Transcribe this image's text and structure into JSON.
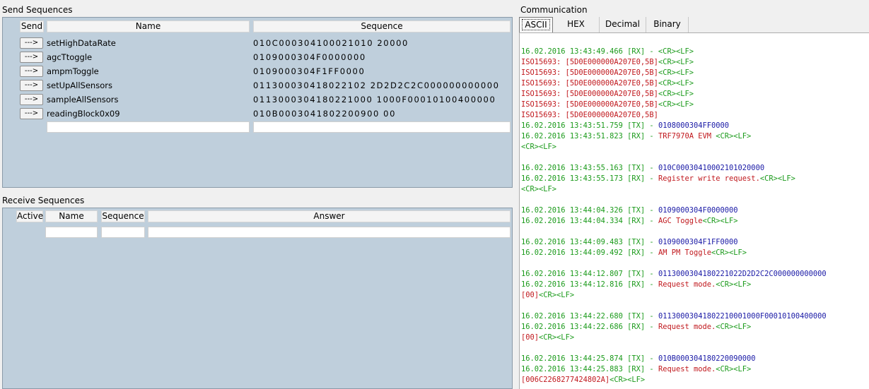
{
  "send_sequences": {
    "title": "Send Sequences",
    "headers": {
      "send": "Send",
      "name": "Name",
      "sequence": "Sequence"
    },
    "rows": [
      {
        "button": "--->",
        "name": "setHighDataRate",
        "sequence": "010C000304100021010 20000"
      },
      {
        "button": "--->",
        "name": "agcTtoggle",
        "sequence": "0109000304F0000000"
      },
      {
        "button": "--->",
        "name": "ampmToggle",
        "sequence": "0109000304F1FF0000"
      },
      {
        "button": "--->",
        "name": "setUpAllSensors",
        "sequence": "011300030418022102 2D2D2C2C000000000000"
      },
      {
        "button": "--->",
        "name": "sampleAllSensors",
        "sequence": "0113000304180221000 1000F00010100400000"
      },
      {
        "button": "--->",
        "name": "readingBlock0x09",
        "sequence": "010B0003041802200900 00"
      }
    ]
  },
  "receive_sequences": {
    "title": "Receive Sequences",
    "headers": {
      "active": "Active",
      "name": "Name",
      "sequence": "Sequence",
      "answer": "Answer"
    }
  },
  "communication": {
    "title": "Communication",
    "tabs": [
      "ASCII",
      "HEX",
      "Decimal",
      "Binary"
    ],
    "active_tab": "ASCII",
    "colors": {
      "timestamp": "#1a9a1a",
      "error": "#c0181d",
      "tx_data": "#1a1aa6"
    },
    "log": [
      [
        {
          "t": "16.02.2016 13:43:49.466 [RX] - <CR><LF>",
          "c": "green"
        }
      ],
      [
        {
          "t": "ISO15693: [5D0E000000A207E0,5B]",
          "c": "red"
        },
        {
          "t": "<CR><LF>",
          "c": "green"
        }
      ],
      [
        {
          "t": "ISO15693: [5D0E000000A207E0,5B]",
          "c": "red"
        },
        {
          "t": "<CR><LF>",
          "c": "green"
        }
      ],
      [
        {
          "t": "ISO15693: [5D0E000000A207E0,5B]",
          "c": "red"
        },
        {
          "t": "<CR><LF>",
          "c": "green"
        }
      ],
      [
        {
          "t": "ISO15693: [5D0E000000A207E0,5B]",
          "c": "red"
        },
        {
          "t": "<CR><LF>",
          "c": "green"
        }
      ],
      [
        {
          "t": "ISO15693: [5D0E000000A207E0,5B]",
          "c": "red"
        },
        {
          "t": "<CR><LF>",
          "c": "green"
        }
      ],
      [
        {
          "t": "ISO15693: [5D0E000000A207E0,5B]",
          "c": "red"
        }
      ],
      [
        {
          "t": "16.02.2016 13:43:51.759 [TX] - ",
          "c": "green"
        },
        {
          "t": "0108000304FF0000",
          "c": "blue"
        }
      ],
      [
        {
          "t": "16.02.2016 13:43:51.823 [RX] - ",
          "c": "green"
        },
        {
          "t": "TRF7970A EVM ",
          "c": "red"
        },
        {
          "t": "<CR><LF>",
          "c": "green"
        }
      ],
      [
        {
          "t": "<CR><LF>",
          "c": "green"
        }
      ],
      [],
      [
        {
          "t": "16.02.2016 13:43:55.163 [TX] - ",
          "c": "green"
        },
        {
          "t": "010C00030410002101020000",
          "c": "blue"
        }
      ],
      [
        {
          "t": "16.02.2016 13:43:55.173 [RX] - ",
          "c": "green"
        },
        {
          "t": "Register write request.",
          "c": "red"
        },
        {
          "t": "<CR><LF>",
          "c": "green"
        }
      ],
      [
        {
          "t": "<CR><LF>",
          "c": "green"
        }
      ],
      [],
      [
        {
          "t": "16.02.2016 13:44:04.326 [TX] - ",
          "c": "green"
        },
        {
          "t": "0109000304F0000000",
          "c": "blue"
        }
      ],
      [
        {
          "t": "16.02.2016 13:44:04.334 [RX] - ",
          "c": "green"
        },
        {
          "t": "AGC Toggle",
          "c": "red"
        },
        {
          "t": "<CR><LF>",
          "c": "green"
        }
      ],
      [],
      [
        {
          "t": "16.02.2016 13:44:09.483 [TX] - ",
          "c": "green"
        },
        {
          "t": "0109000304F1FF0000",
          "c": "blue"
        }
      ],
      [
        {
          "t": "16.02.2016 13:44:09.492 [RX] - ",
          "c": "green"
        },
        {
          "t": "AM PM Toggle",
          "c": "red"
        },
        {
          "t": "<CR><LF>",
          "c": "green"
        }
      ],
      [],
      [
        {
          "t": "16.02.2016 13:44:12.807 [TX] - ",
          "c": "green"
        },
        {
          "t": "0113000304180221022D2D2C2C000000000000",
          "c": "blue"
        }
      ],
      [
        {
          "t": "16.02.2016 13:44:12.816 [RX] - ",
          "c": "green"
        },
        {
          "t": "Request mode.",
          "c": "red"
        },
        {
          "t": "<CR><LF>",
          "c": "green"
        }
      ],
      [
        {
          "t": "[00]",
          "c": "red"
        },
        {
          "t": "<CR><LF>",
          "c": "green"
        }
      ],
      [],
      [
        {
          "t": "16.02.2016 13:44:22.680 [TX] - ",
          "c": "green"
        },
        {
          "t": "01130003041802210001000F00010100400000",
          "c": "blue"
        }
      ],
      [
        {
          "t": "16.02.2016 13:44:22.686 [RX] - ",
          "c": "green"
        },
        {
          "t": "Request mode.",
          "c": "red"
        },
        {
          "t": "<CR><LF>",
          "c": "green"
        }
      ],
      [
        {
          "t": "[00]",
          "c": "red"
        },
        {
          "t": "<CR><LF>",
          "c": "green"
        }
      ],
      [],
      [
        {
          "t": "16.02.2016 13:44:25.874 [TX] - ",
          "c": "green"
        },
        {
          "t": "010B000304180220090000",
          "c": "blue"
        }
      ],
      [
        {
          "t": "16.02.2016 13:44:25.883 [RX] - ",
          "c": "green"
        },
        {
          "t": "Request mode.",
          "c": "red"
        },
        {
          "t": "<CR><LF>",
          "c": "green"
        }
      ],
      [
        {
          "t": "[006C2268277424802A]",
          "c": "red"
        },
        {
          "t": "<CR><LF>",
          "c": "green"
        }
      ]
    ]
  }
}
